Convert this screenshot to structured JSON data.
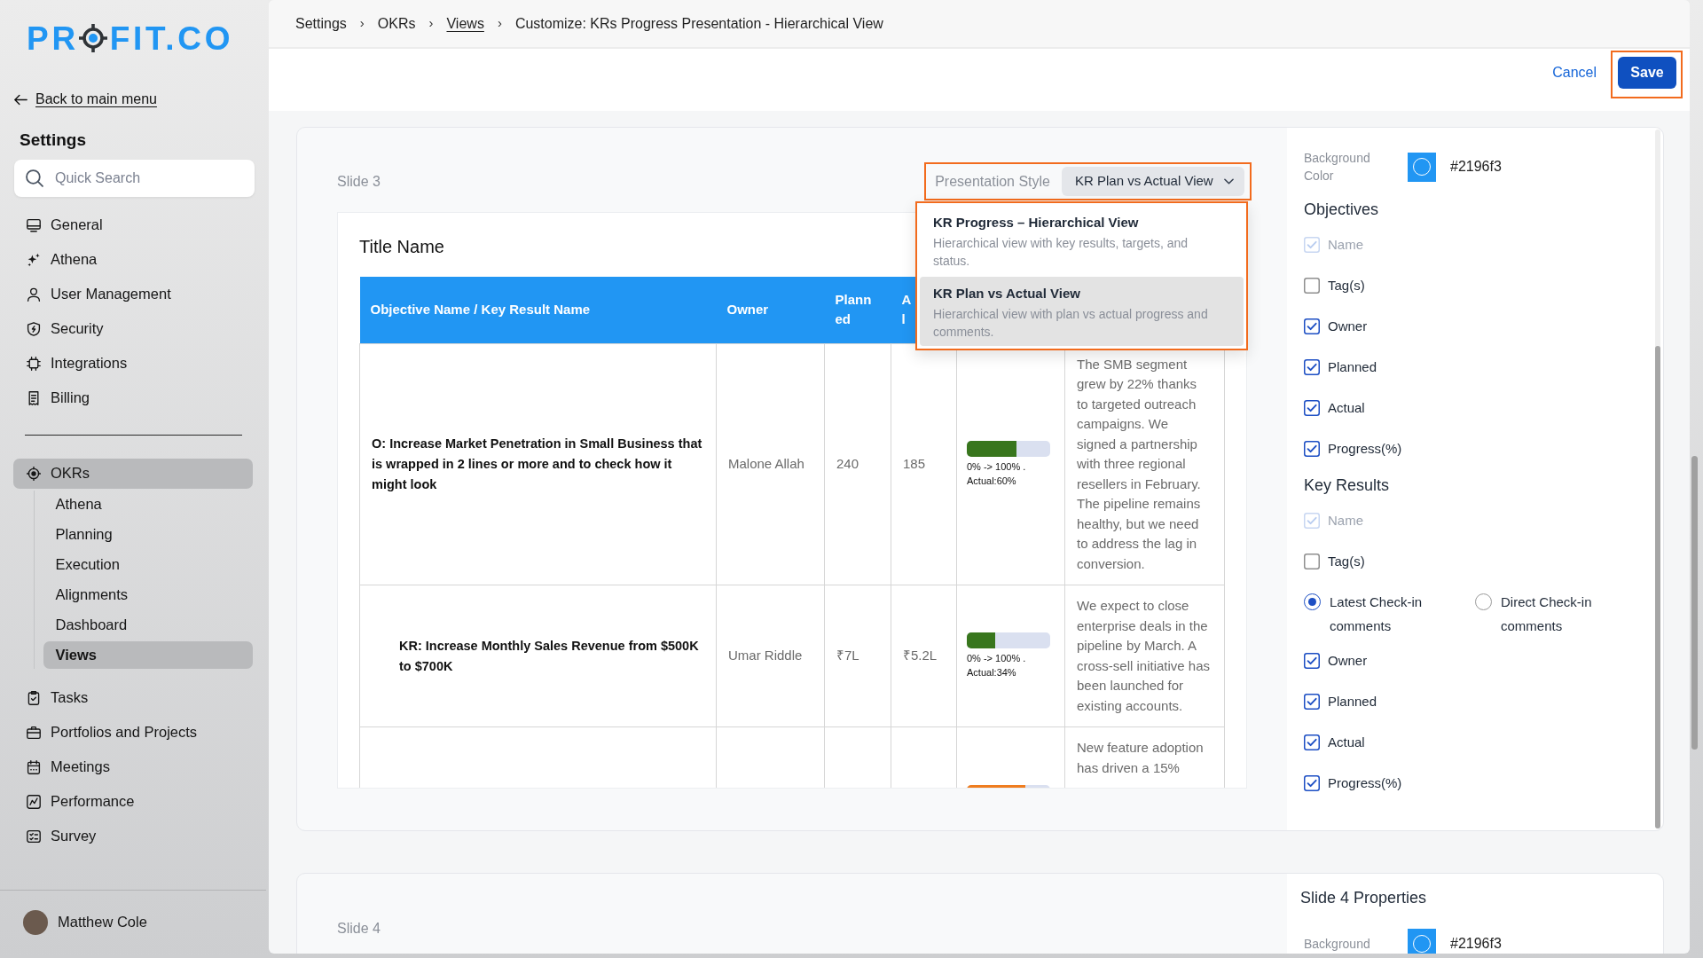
{
  "sidebar": {
    "logo": {
      "text_before_mark": "PR",
      "text_after_mark": "FIT.CO"
    },
    "back_link": "Back to main menu",
    "title": "Settings",
    "search": {
      "placeholder": "Quick Search"
    },
    "settings_items": [
      {
        "label": "General",
        "selected": false
      },
      {
        "label": "Athena",
        "selected": false
      },
      {
        "label": "User Management",
        "selected": false
      },
      {
        "label": "Security",
        "selected": false
      },
      {
        "label": "Integrations",
        "selected": false
      },
      {
        "label": "Billing",
        "selected": false
      }
    ],
    "module_items": [
      {
        "label": "OKRs",
        "selected": true,
        "children": [
          {
            "label": "Athena",
            "selected": false
          },
          {
            "label": "Planning",
            "selected": false
          },
          {
            "label": "Execution",
            "selected": false
          },
          {
            "label": "Alignments",
            "selected": false
          },
          {
            "label": "Dashboard",
            "selected": false
          },
          {
            "label": "Views",
            "selected": true
          }
        ]
      },
      {
        "label": "Tasks",
        "selected": false
      },
      {
        "label": "Portfolios and Projects",
        "selected": false
      },
      {
        "label": "Meetings",
        "selected": false
      },
      {
        "label": "Performance",
        "selected": false
      },
      {
        "label": "Survey",
        "selected": false
      }
    ],
    "user": {
      "name": "Matthew Cole"
    }
  },
  "breadcrumb": [
    {
      "kind": "crumb",
      "label": "Settings"
    },
    {
      "kind": "separator",
      "label": "›"
    },
    {
      "kind": "crumb",
      "label": "OKRs"
    },
    {
      "kind": "separator",
      "label": "›"
    },
    {
      "kind": "link",
      "label": "Views"
    },
    {
      "kind": "separator",
      "label": "›"
    },
    {
      "kind": "current",
      "label": "Customize: KRs Progress Presentation - Hierarchical View"
    }
  ],
  "actions": {
    "cancel": "Cancel",
    "save": {
      "label": "Save",
      "highlighted": true
    }
  },
  "slides": [
    {
      "label": "Slide 3",
      "presentation_style": {
        "label": "Presentation Style",
        "value": "KR Plan vs Actual View",
        "highlighted": true,
        "expanded": true,
        "menu": {
          "highlighted": true,
          "options": [
            {
              "title": "KR Progress – Hierarchical View",
              "description": "Hierarchical view with key results, targets, and status.",
              "selected": false
            },
            {
              "title": "KR Plan vs Actual View",
              "description": "Hierarchical view with plan vs actual progress and comments.",
              "selected": true
            }
          ]
        }
      },
      "preview": {
        "title": "Title Name",
        "columns": [
          {
            "label": "Objective Name / Key Result Name"
          },
          {
            "label": "Owner"
          },
          {
            "label": "Planned"
          },
          {
            "label": "A\nl"
          }
        ],
        "rows": [
          {
            "kind": "objective",
            "name": "O: Increase Market Penetration in Small Business that is wrapped in 2 lines or more and to check how it might look",
            "owner": "Malone Allah",
            "planned": "240",
            "actual": "185",
            "progress": {
              "level": 0.6,
              "color": "#38761d",
              "label": "0% -> 100% . Actual:60%"
            },
            "comment": "The SMB segment grew by 22% thanks to targeted outreach campaigns. We signed a partnership with three regional resellers in February. The pipeline remains healthy, but we need to address the lag in conversion."
          },
          {
            "kind": "key_result",
            "name": "KR: Increase Monthly Sales Revenue from $500K to $700K",
            "owner": "Umar Riddle",
            "planned": "₹7L",
            "actual": "₹5.2L",
            "progress": {
              "level": 0.34,
              "color": "#38761d",
              "label": "0% -> 100% . Actual:34%"
            },
            "comment": "We expect to close enterprise deals in the pipeline by March. A cross-sell initiative has been launched for existing accounts."
          },
          {
            "progress": {
              "level": 0.7,
              "color": "#ef7d1f"
            },
            "comment": "New feature adoption has driven a 15%"
          }
        ]
      },
      "properties": {
        "background": {
          "label": "Background Color",
          "value": "#2196f3",
          "color": "#2196f3"
        },
        "sections": [
          {
            "title": "Objectives",
            "options": [
              {
                "kind": "checkbox",
                "label": "Name",
                "checked": true,
                "disabled": true
              },
              {
                "kind": "checkbox",
                "label": "Tag(s)",
                "checked": false,
                "disabled": false
              },
              {
                "kind": "checkbox",
                "label": "Owner",
                "checked": true,
                "disabled": false
              },
              {
                "kind": "checkbox",
                "label": "Planned",
                "checked": true,
                "disabled": false
              },
              {
                "kind": "checkbox",
                "label": "Actual",
                "checked": true,
                "disabled": false
              },
              {
                "kind": "checkbox",
                "label": "Progress(%)",
                "checked": true,
                "disabled": false
              }
            ]
          },
          {
            "title": "Key Results",
            "options": [
              {
                "kind": "checkbox",
                "label": "Name",
                "checked": true,
                "disabled": true
              },
              {
                "kind": "checkbox",
                "label": "Tag(s)",
                "checked": false,
                "disabled": false
              },
              {
                "kind": "radio_group",
                "choices": [
                  {
                    "label": "Latest Check-in comments",
                    "selected": true
                  },
                  {
                    "label": "Direct Check-in comments",
                    "selected": false
                  }
                ]
              },
              {
                "kind": "checkbox",
                "label": "Owner",
                "checked": true,
                "disabled": false
              },
              {
                "kind": "checkbox",
                "label": "Planned",
                "checked": true,
                "disabled": false
              },
              {
                "kind": "checkbox",
                "label": "Actual",
                "checked": true,
                "disabled": false
              },
              {
                "kind": "checkbox",
                "label": "Progress(%)",
                "checked": true,
                "disabled": false
              }
            ]
          }
        ]
      }
    },
    {
      "label": "Slide 4",
      "properties": {
        "title": "Slide 4 Properties",
        "background": {
          "label": "Background",
          "value": "#2196f3",
          "color": "#2196f3"
        }
      }
    }
  ]
}
